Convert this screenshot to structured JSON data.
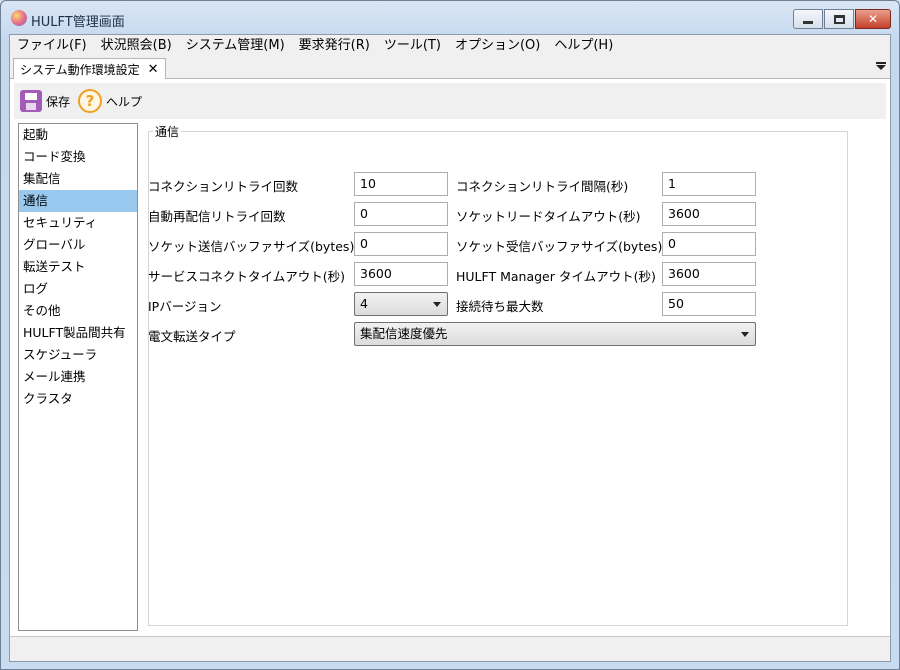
{
  "window": {
    "title": "HULFT管理画面"
  },
  "menu": [
    "ファイル(F)",
    "状況照会(B)",
    "システム管理(M)",
    "要求発行(R)",
    "ツール(T)",
    "オプション(O)",
    "ヘルプ(H)"
  ],
  "tab": {
    "label": "システム動作環境設定",
    "close": "✕"
  },
  "toolbar": {
    "save_label": "保存",
    "help_label": "ヘルプ",
    "help_glyph": "?"
  },
  "nav": {
    "items": [
      "起動",
      "コード変換",
      "集配信",
      "通信",
      "セキュリティ",
      "グローバル",
      "転送テスト",
      "ログ",
      "その他",
      "HULFT製品間共有",
      "スケジューラ",
      "メール連携",
      "クラスタ"
    ],
    "selected": "通信"
  },
  "section": {
    "title": "通信",
    "fields": {
      "conn_retry_count": {
        "label": "コネクションリトライ回数",
        "value": "10"
      },
      "conn_retry_interval": {
        "label": "コネクションリトライ間隔(秒)",
        "value": "1"
      },
      "auto_redeliver_retry": {
        "label": "自動再配信リトライ回数",
        "value": "0"
      },
      "socket_read_timeout": {
        "label": "ソケットリードタイムアウト(秒)",
        "value": "3600"
      },
      "socket_send_buffer": {
        "label": "ソケット送信バッファサイズ(bytes)",
        "value": "0"
      },
      "socket_recv_buffer": {
        "label": "ソケット受信バッファサイズ(bytes)",
        "value": "0"
      },
      "service_connect_timeout": {
        "label": "サービスコネクトタイムアウト(秒)",
        "value": "3600"
      },
      "manager_timeout": {
        "label": "HULFT Manager タイムアウト(秒)",
        "value": "3600"
      },
      "ip_version": {
        "label": "IPバージョン",
        "value": "4"
      },
      "max_accept_wait": {
        "label": "接続待ち最大数",
        "value": "50"
      },
      "telegram_type": {
        "label": "電文転送タイプ",
        "value": "集配信速度優先"
      }
    }
  }
}
